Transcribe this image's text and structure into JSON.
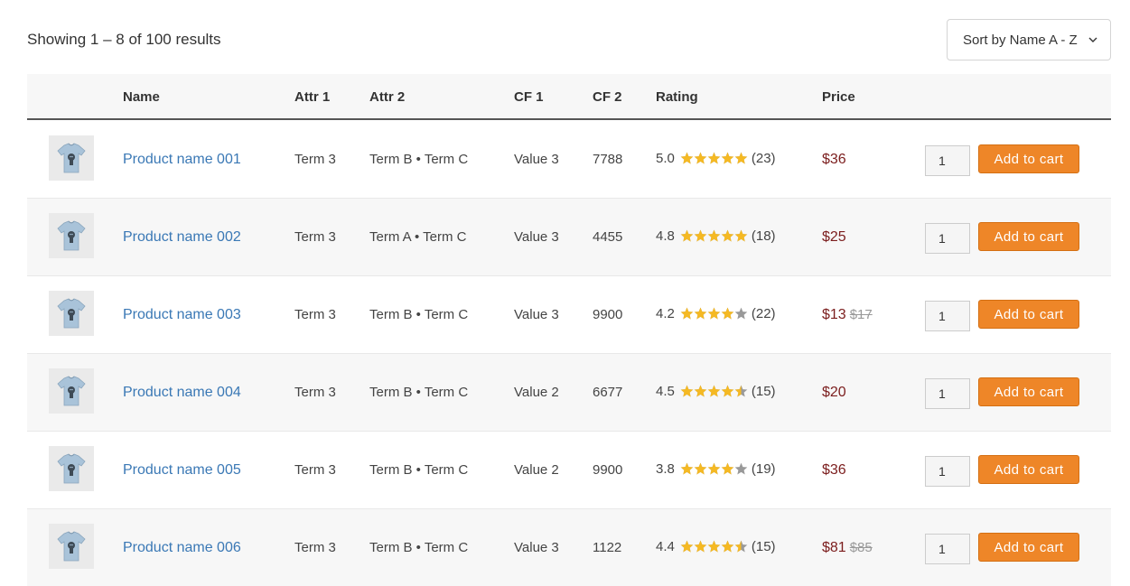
{
  "results_text": "Showing 1 – 8 of 100 results",
  "sort": {
    "label": "Sort by Name A - Z"
  },
  "columns": {
    "name": "Name",
    "attr1": "Attr 1",
    "attr2": "Attr 2",
    "cf1": "CF 1",
    "cf2": "CF 2",
    "rating": "Rating",
    "price": "Price"
  },
  "colors": {
    "accent": "#ee8628",
    "link": "#3a78b5",
    "price": "#7b1d1d",
    "star": "#f5b923",
    "star_empty": "#999999"
  },
  "add_to_cart_label": "Add to cart",
  "products": [
    {
      "name": "Product name 001",
      "attr1": "Term 3",
      "attr2": "Term B • Term C",
      "cf1": "Value 3",
      "cf2": "7788",
      "rating": "5.0",
      "rating_value": 5.0,
      "reviews": "(23)",
      "price": "$36",
      "old_price": "",
      "qty": "1"
    },
    {
      "name": "Product name 002",
      "attr1": "Term 3",
      "attr2": "Term A • Term C",
      "cf1": "Value 3",
      "cf2": "4455",
      "rating": "4.8",
      "rating_value": 4.8,
      "reviews": "(18)",
      "price": "$25",
      "old_price": "",
      "qty": "1"
    },
    {
      "name": "Product name 003",
      "attr1": "Term 3",
      "attr2": "Term B • Term C",
      "cf1": "Value 3",
      "cf2": "9900",
      "rating": "4.2",
      "rating_value": 4.2,
      "reviews": "(22)",
      "price": "$13",
      "old_price": "$17",
      "qty": "1"
    },
    {
      "name": "Product name 004",
      "attr1": "Term 3",
      "attr2": "Term B • Term C",
      "cf1": "Value 2",
      "cf2": "6677",
      "rating": "4.5",
      "rating_value": 4.5,
      "reviews": "(15)",
      "price": "$20",
      "old_price": "",
      "qty": "1"
    },
    {
      "name": "Product name 005",
      "attr1": "Term 3",
      "attr2": "Term B • Term C",
      "cf1": "Value 2",
      "cf2": "9900",
      "rating": "3.8",
      "rating_value": 3.8,
      "reviews": "(19)",
      "price": "$36",
      "old_price": "",
      "qty": "1"
    },
    {
      "name": "Product name 006",
      "attr1": "Term 3",
      "attr2": "Term B • Term C",
      "cf1": "Value 3",
      "cf2": "1122",
      "rating": "4.4",
      "rating_value": 4.4,
      "reviews": "(15)",
      "price": "$81",
      "old_price": "$85",
      "qty": "1"
    }
  ],
  "icons": {
    "thumbnail": "tshirt-icon",
    "star": "star-icon",
    "sort_chevron": "chevron-down-icon"
  }
}
